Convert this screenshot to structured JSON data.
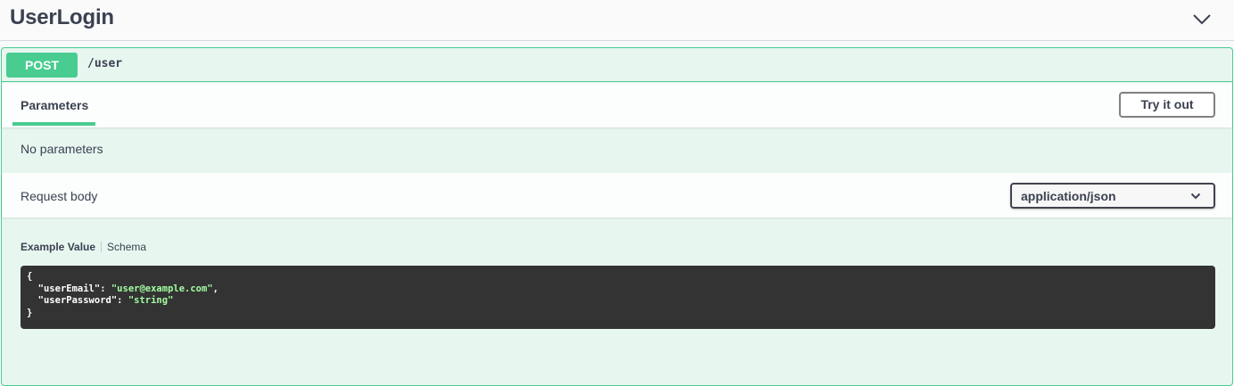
{
  "tag": {
    "title": "UserLogin"
  },
  "operation": {
    "method": "POST",
    "path": "/user",
    "colors": {
      "method_bg": "#49cc90",
      "block_bg": "#e8f6f0",
      "border": "#49cc90"
    }
  },
  "parameters": {
    "tab_label": "Parameters",
    "try_it_out_label": "Try it out",
    "empty_text": "No parameters"
  },
  "request_body": {
    "label": "Request body",
    "content_type": "application/json",
    "model_tabs": {
      "example_label": "Example Value",
      "schema_label": "Schema"
    },
    "example": {
      "open_brace": "{",
      "close_brace": "}",
      "fields": [
        {
          "key": "\"userEmail\"",
          "value": "\"user@example.com\"",
          "trailing": ","
        },
        {
          "key": "\"userPassword\"",
          "value": "\"string\"",
          "trailing": ""
        }
      ]
    }
  },
  "icons": {
    "collapse": "chevron-down-icon",
    "select_arrow": "chevron-down-icon"
  }
}
